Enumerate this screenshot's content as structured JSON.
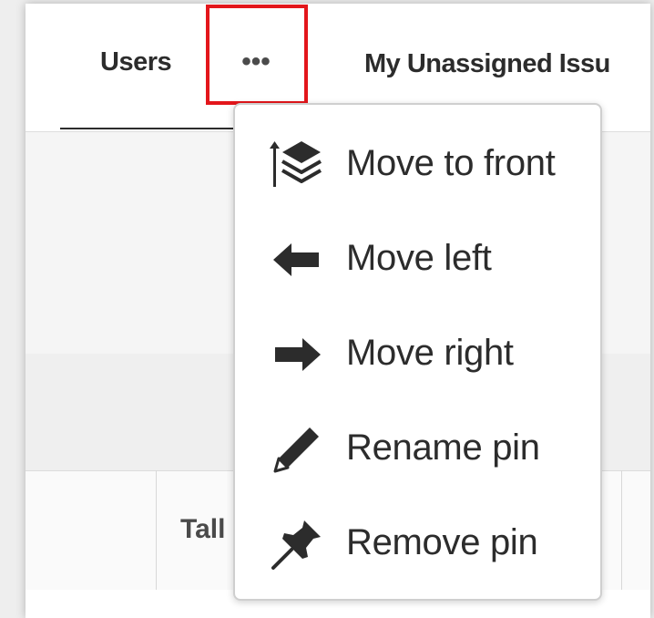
{
  "tabs": {
    "users_label": "Users",
    "more_label": "•••",
    "unassigned_label": "My Unassigned Issu"
  },
  "table": {
    "header_label": "Tall"
  },
  "menu": {
    "items": [
      {
        "label": "Move to front",
        "icon": "layers-front-icon"
      },
      {
        "label": "Move left",
        "icon": "arrow-left-icon"
      },
      {
        "label": "Move right",
        "icon": "arrow-right-icon"
      },
      {
        "label": "Rename pin",
        "icon": "pencil-icon"
      },
      {
        "label": "Remove pin",
        "icon": "pin-icon"
      }
    ]
  },
  "colors": {
    "highlight": "#e3161b",
    "text": "#2c2c2c"
  }
}
